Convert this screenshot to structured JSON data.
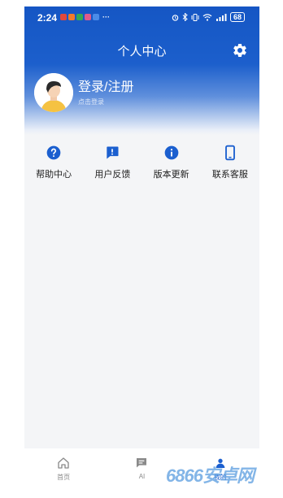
{
  "status_bar": {
    "time": "2:24",
    "more": "···",
    "battery": "68"
  },
  "header": {
    "title": "个人中心",
    "settings_icon": "gear-icon"
  },
  "profile": {
    "login_label": "登录/注册",
    "login_hint": "点击登录",
    "avatar_icon": "user-avatar"
  },
  "actions": [
    {
      "label": "帮助中心",
      "icon": "question-circle-icon"
    },
    {
      "label": "用户反馈",
      "icon": "feedback-icon"
    },
    {
      "label": "版本更新",
      "icon": "info-circle-icon"
    },
    {
      "label": "联系客服",
      "icon": "phone-icon"
    }
  ],
  "tabbar": [
    {
      "label": "首页",
      "icon": "home-icon"
    },
    {
      "label": "AI",
      "icon": "chat-icon"
    },
    {
      "label": "我的",
      "icon": "user-icon",
      "active": true
    }
  ],
  "watermark": {
    "text": "6866安卓网"
  },
  "colors": {
    "primary": "#1b5fcf",
    "background": "#f4f5f7",
    "text": "#222222",
    "tab_inactive": "#8a8a8a"
  }
}
